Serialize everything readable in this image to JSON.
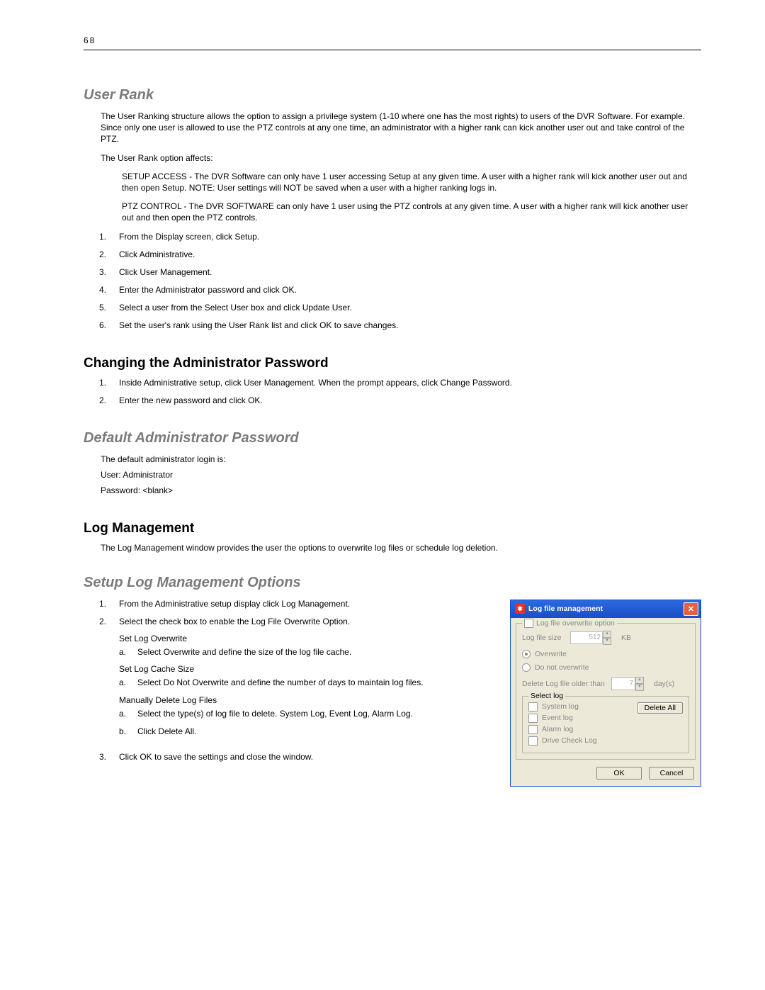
{
  "page_number": "68",
  "user_rank": {
    "heading": "User Rank",
    "intro": "The User Ranking structure allows the option to assign a privilege system (1-10 where one has the most rights) to users of the DVR Software.  For example.  Since only one user is allowed to use the PTZ controls at any one time, an administrator with a higher rank can kick another user out and take control of the PTZ.",
    "affects_label": "The User Rank option affects:",
    "setup_access": "SETUP ACCESS - The DVR Software can only have 1 user accessing Setup at any given time.  A user with a higher rank will kick another user out and then open Setup.  NOTE:  User settings will NOT be saved when a user with a higher ranking logs in.",
    "ptz_control": "PTZ CONTROL - The DVR SOFTWARE can only have 1 user using the PTZ controls at any given time.  A user with a higher rank will kick another user out and then open the PTZ controls.",
    "steps": [
      "From the Display screen, click Setup.",
      "Click Administrative.",
      "Click User Management.",
      "Enter the Administrator password and click OK.",
      "Select a user from the Select User box and click Update User.",
      "Set the user's rank using the User Rank list and click OK to save changes."
    ]
  },
  "change_pw": {
    "heading": "Changing the Administrator Password",
    "steps": [
      "Inside Administrative setup, click User Management. When the prompt appears, click Change Password.",
      "Enter the new password and click OK."
    ]
  },
  "default_pw": {
    "heading": "Default Administrator Password",
    "intro": "The default administrator login is:",
    "user": "User: Administrator",
    "password": "Password: <blank>"
  },
  "log_mgmt": {
    "heading": "Log Management",
    "intro": "The Log Management window provides the user the options to overwrite log files or schedule log deletion."
  },
  "setup_log": {
    "heading": "Setup Log Management Options",
    "steps_top": [
      "From the Administrative setup display click Log Management.",
      "Select the check box to enable the Log File Overwrite Option."
    ],
    "set_overwrite_label": "Set Log Overwrite",
    "set_overwrite_a": "Select Overwrite and define the size of the log file cache.",
    "set_cache_label": "Set Log Cache Size",
    "set_cache_a": "Select Do Not Overwrite and define the number of days to maintain log files.",
    "manual_delete_label": "Manually Delete Log Files",
    "manual_delete_a": "Select the type(s) of log file to delete.  System Log, Event Log, Alarm Log.",
    "manual_delete_b": "Click Delete All.",
    "step3": "Click OK to save the settings and close the window."
  },
  "dialog": {
    "title": "Log file management",
    "group_title": "Log file overwrite option",
    "log_file_size_label": "Log file size",
    "log_file_size_value": "512",
    "kb": "KB",
    "overwrite": "Overwrite",
    "do_not_overwrite": "Do not overwrite",
    "delete_older_label": "Delete Log file older than",
    "delete_older_value": "7",
    "days": "day(s)",
    "select_log_label": "Select log",
    "logs": {
      "system": "System log",
      "event": "Event log",
      "alarm": "Alarm log",
      "drive": "Drive Check Log"
    },
    "delete_all": "Delete All",
    "ok": "OK",
    "cancel": "Cancel"
  }
}
